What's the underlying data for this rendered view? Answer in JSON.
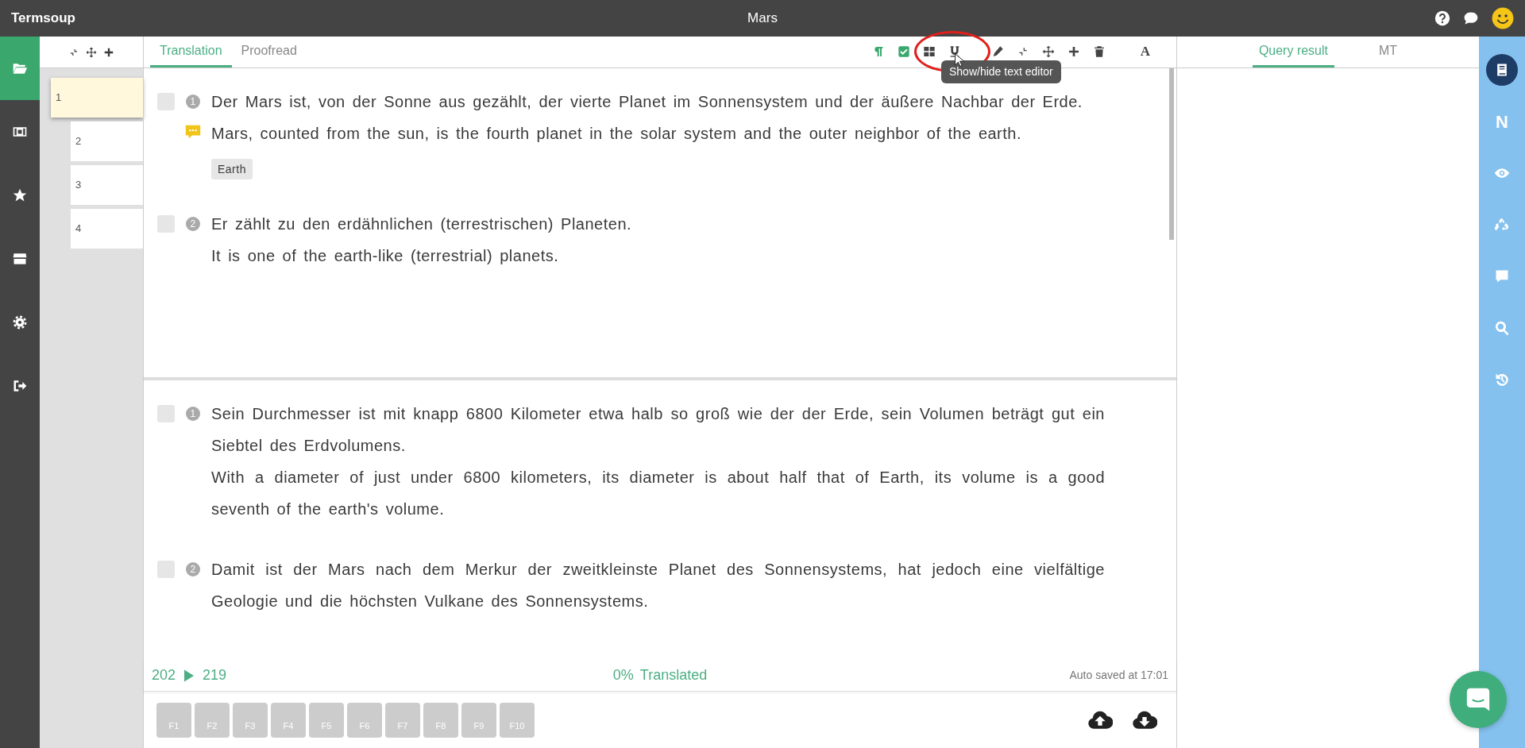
{
  "app": {
    "name": "Termsoup",
    "title": "Mars"
  },
  "top_icons": [
    {
      "kind": "help"
    },
    {
      "kind": "chat"
    },
    {
      "kind": "avatar"
    }
  ],
  "nav": [
    {
      "kind": "folder",
      "selected": true
    },
    {
      "kind": "panel",
      "selected": false
    },
    {
      "kind": "star",
      "selected": false
    },
    {
      "kind": "store",
      "selected": false
    },
    {
      "kind": "gear",
      "selected": false
    },
    {
      "kind": "signout",
      "selected": false
    }
  ],
  "segment_list": {
    "tools": [
      {
        "kind": "compress"
      },
      {
        "kind": "move"
      },
      {
        "kind": "plus"
      }
    ],
    "items": [
      {
        "label": "1",
        "selected": true
      },
      {
        "label": "2",
        "selected": false
      },
      {
        "label": "3",
        "selected": false
      },
      {
        "label": "4",
        "selected": false
      }
    ]
  },
  "tabs": [
    {
      "label": "Translation",
      "selected": true
    },
    {
      "label": "Proofread",
      "selected": false
    }
  ],
  "toolbar": [
    {
      "kind": "pilcrow",
      "on": true
    },
    {
      "kind": "checkbox",
      "on": true
    },
    {
      "kind": "grid",
      "on": false
    },
    {
      "kind": "underline",
      "on": false,
      "tooltip": "Show/hide text editor"
    },
    {
      "kind": "pencil",
      "on": false
    },
    {
      "kind": "compress",
      "on": false
    },
    {
      "kind": "move",
      "on": false
    },
    {
      "kind": "plus",
      "on": false
    },
    {
      "kind": "trash",
      "on": false
    },
    {
      "kind": "font",
      "on": false,
      "label": "A"
    }
  ],
  "panes": [
    {
      "segments": [
        {
          "number": "1",
          "checked": false,
          "comment": true,
          "source": "Der Mars ist, von der Sonne aus gezählt, der vierte Planet im Sonnensystem und der äußere Nachbar der Erde.",
          "target": "Mars, counted from the sun, is the fourth planet in the solar system and the outer neighbor of the earth.",
          "terms": [
            "Earth"
          ]
        },
        {
          "number": "2",
          "checked": false,
          "comment": false,
          "source": "Er zählt zu den erdähnlichen (terrestrischen) Planeten.",
          "target": "It is one of the earth-like (terrestrial) planets."
        }
      ]
    },
    {
      "segments": [
        {
          "number": "1",
          "checked": false,
          "comment": false,
          "source": "Sein Durchmesser ist mit knapp 6800 Kilometer etwa halb so groß wie der der Erde, sein Volumen beträgt gut ein Siebtel des Erdvolumens.",
          "target": "With a diameter of just under 6800 kilometers, its diameter is about half that of Earth, its volume is a good seventh of the earth's volume."
        },
        {
          "number": "2",
          "checked": false,
          "comment": false,
          "source": "Damit ist der Mars nach dem Merkur der zweitkleinste Planet des Sonnensystems, hat jedoch eine vielfältige Geologie und die höchsten Vulkane des Sonnensystems."
        }
      ]
    }
  ],
  "status": {
    "from": "202",
    "to": "219",
    "percent": "0%",
    "progress_label": "Translated",
    "saved": "Auto saved at 17:01"
  },
  "function_keys": [
    "F1",
    "F2",
    "F3",
    "F4",
    "F5",
    "F6",
    "F7",
    "F8",
    "F9",
    "F10"
  ],
  "file_actions": [
    {
      "kind": "upload"
    },
    {
      "kind": "download"
    }
  ],
  "right_tabs": [
    {
      "label": "Query result",
      "selected": true
    },
    {
      "label": "MT",
      "selected": false
    }
  ],
  "rail": [
    {
      "kind": "book",
      "selected": true
    },
    {
      "kind": "letter",
      "label": "N",
      "selected": false
    },
    {
      "kind": "eye",
      "selected": false
    },
    {
      "kind": "recycle",
      "selected": false
    },
    {
      "kind": "comment",
      "selected": false
    },
    {
      "kind": "search",
      "selected": false
    },
    {
      "kind": "history",
      "selected": false
    }
  ]
}
